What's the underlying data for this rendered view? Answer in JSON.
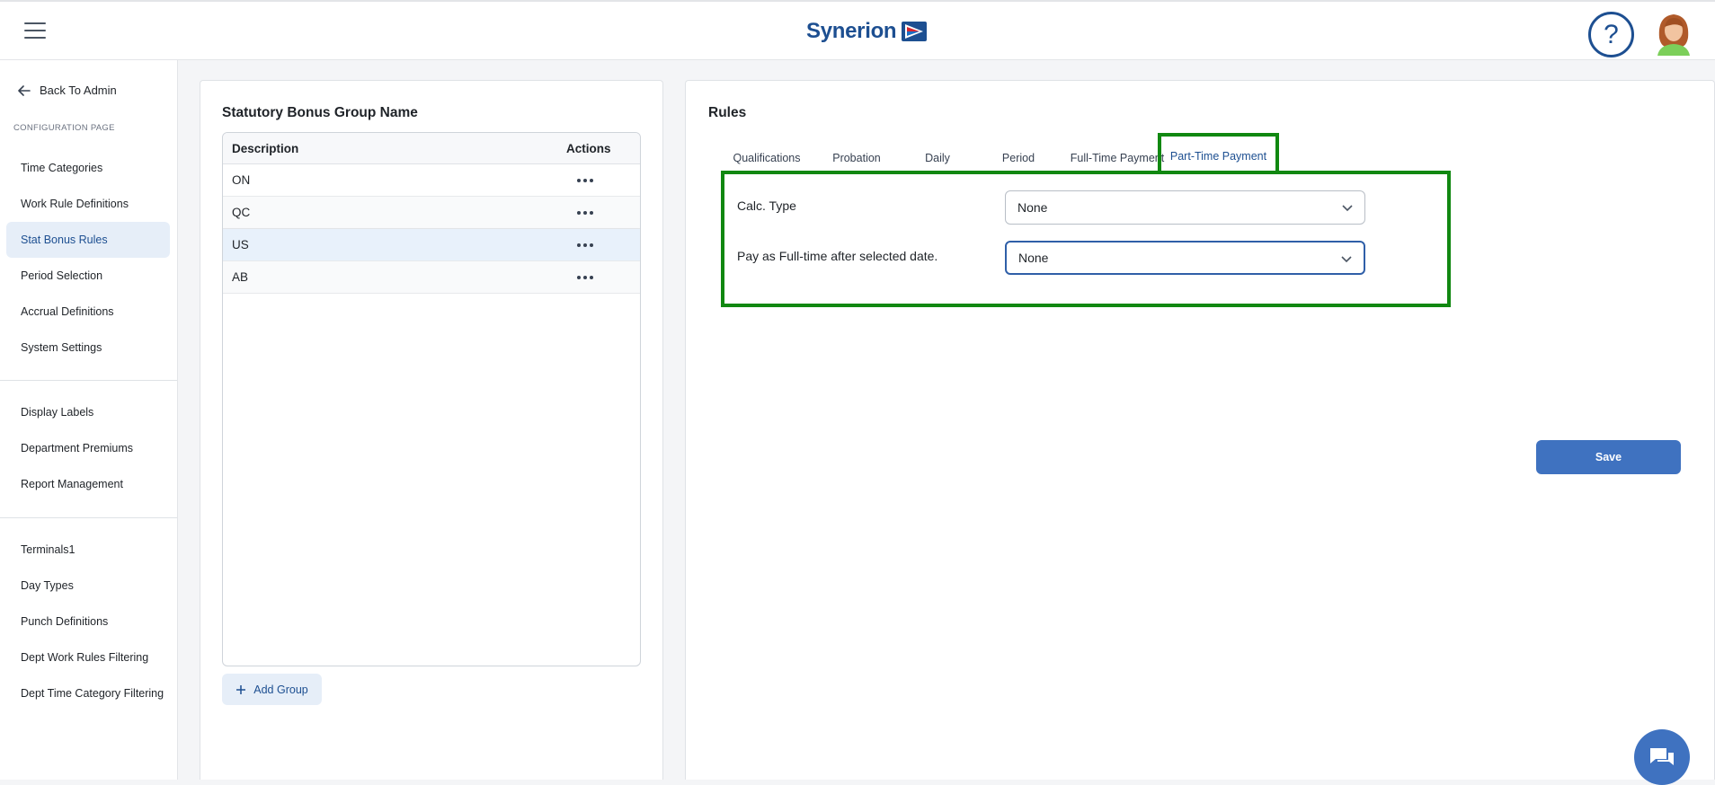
{
  "header": {
    "logo_text": "Synerion"
  },
  "sidebar": {
    "back_label": "Back To Admin",
    "section_label": "CONFIGURATION PAGE",
    "group1": [
      "Time Categories",
      "Work Rule Definitions",
      "Stat Bonus Rules",
      "Period Selection",
      "Accrual Definitions",
      "System Settings"
    ],
    "group2": [
      "Display Labels",
      "Department Premiums",
      "Report Management"
    ],
    "group3": [
      "Terminals1",
      "Day Types",
      "Punch Definitions",
      "Dept Work Rules Filtering",
      "Dept Time Category Filtering"
    ],
    "active": "Stat Bonus Rules"
  },
  "groups_panel": {
    "title": "Statutory Bonus Group Name",
    "columns": [
      "Description",
      "Actions"
    ],
    "rows": [
      "ON",
      "QC",
      "US",
      "AB"
    ],
    "selected": "US",
    "add_label": "Add Group"
  },
  "rules_panel": {
    "title": "Rules",
    "tabs": [
      "Qualifications",
      "Probation",
      "Daily",
      "Period",
      "Full-Time Payment",
      "Part-Time Payment"
    ],
    "active_tab": "Part-Time Payment",
    "fields": [
      {
        "label": "Calc. Type",
        "value": "None"
      },
      {
        "label": "Pay as Full-time after selected date.",
        "value": "None"
      }
    ],
    "save_label": "Save"
  },
  "colors": {
    "brand": "#1d4f91",
    "accent": "#3f72c0",
    "highlight": "#118811",
    "active_bg": "#e6eef8"
  }
}
